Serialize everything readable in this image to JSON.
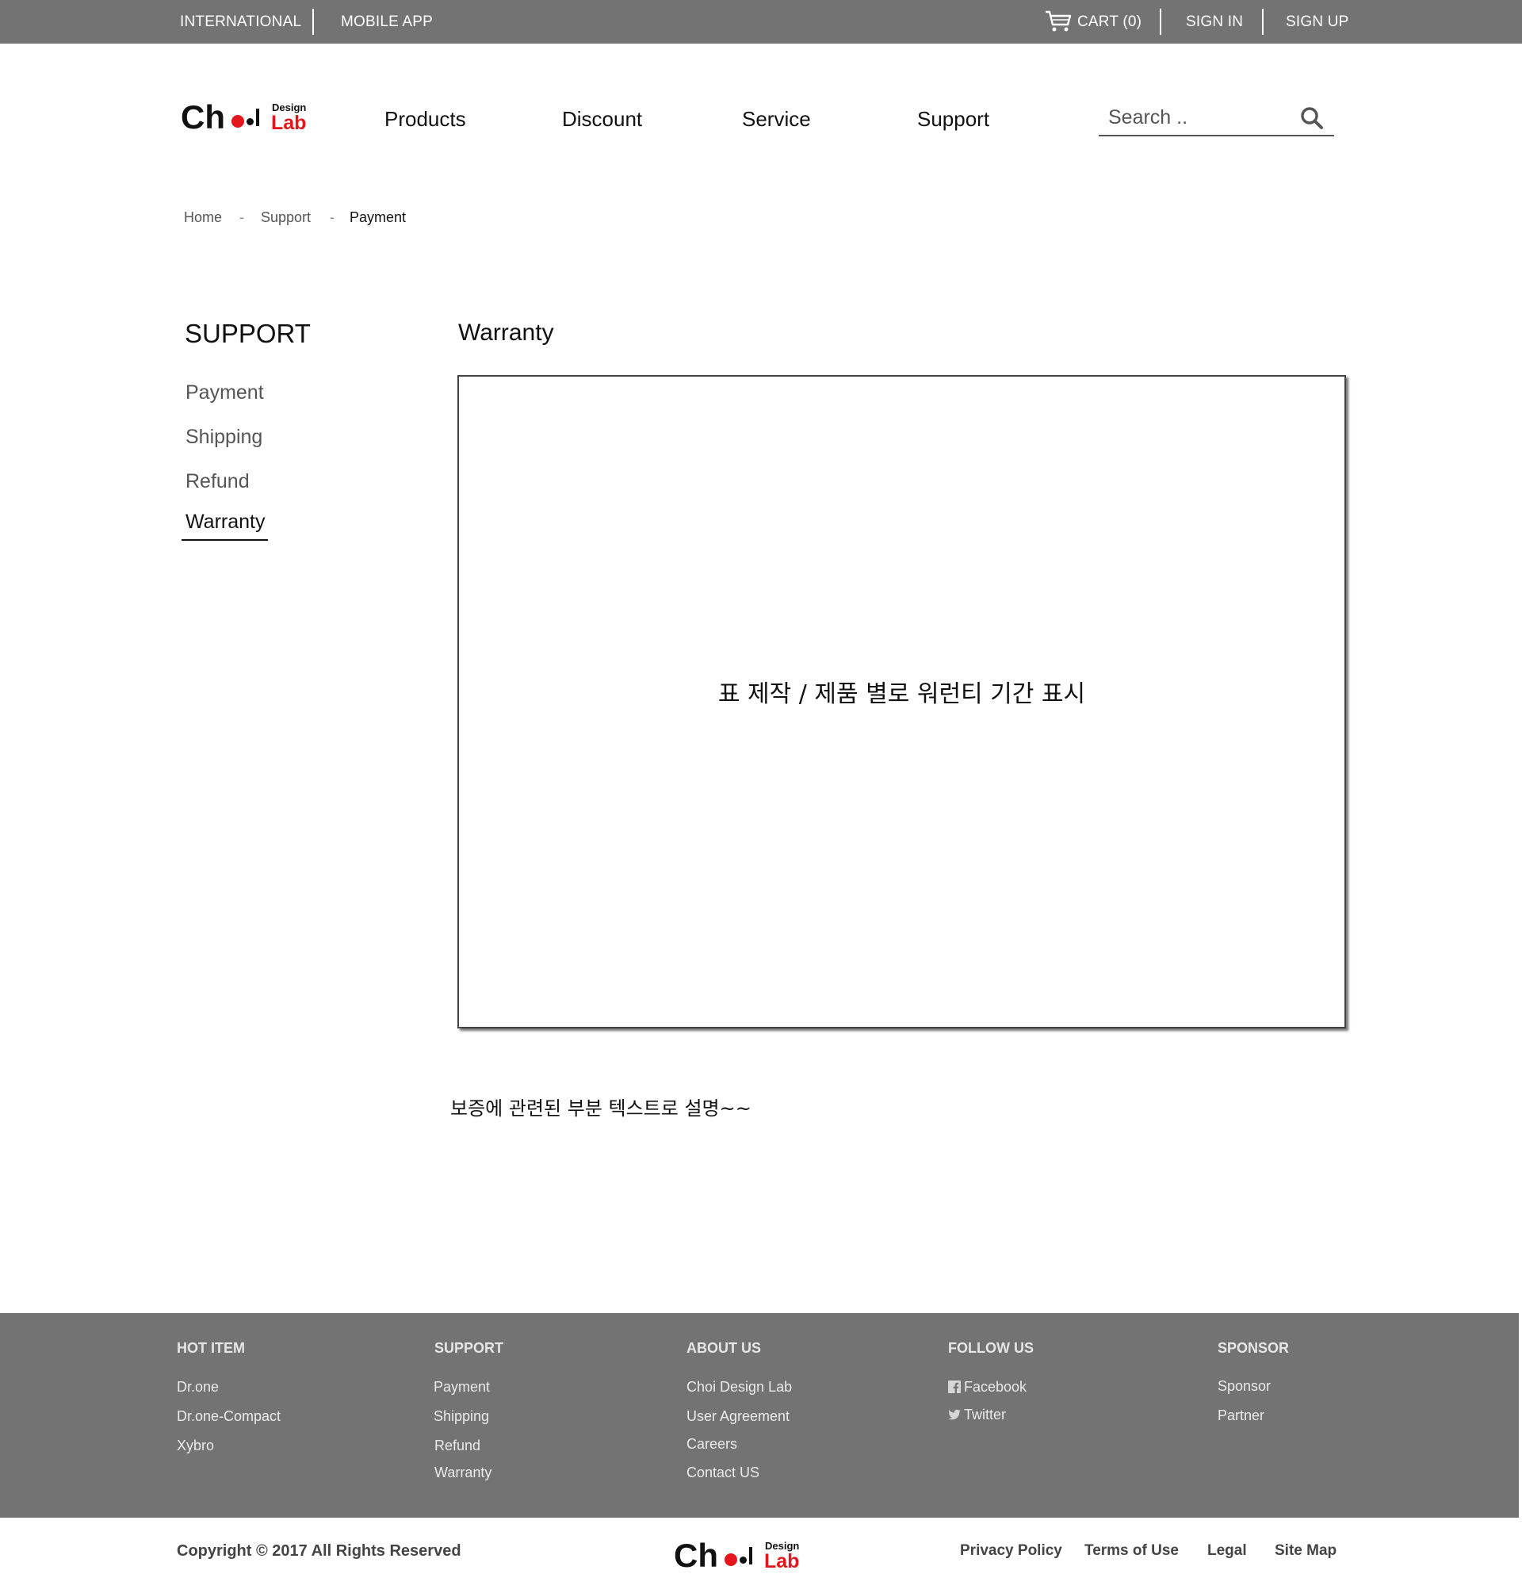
{
  "topbar": {
    "international": "INTERNATIONAL",
    "mobile_app": "MOBILE APP",
    "cart": "CART (0)",
    "sign_in": "SIGN IN",
    "sign_up": "SIGN UP"
  },
  "brand": {
    "name_prefix": "Ch",
    "design": "Design",
    "lab": "Lab"
  },
  "nav": {
    "items": [
      "Products",
      "Discount",
      "Service",
      "Support"
    ]
  },
  "search": {
    "placeholder": "Search .."
  },
  "breadcrumb": {
    "home": "Home",
    "support": "Support",
    "current": "Payment",
    "separator": "-"
  },
  "sidebar": {
    "title": "SUPPORT",
    "items": [
      "Payment",
      "Shipping",
      "Refund",
      "Warranty"
    ],
    "active": "Warranty"
  },
  "main": {
    "title": "Warranty",
    "table_placeholder": "표 제작 / 제품 별로 워런티 기간 표시",
    "description": "보증에 관련된 부분 텍스트로 설명~~"
  },
  "footer": {
    "columns": [
      {
        "heading": "HOT ITEM",
        "links": [
          "Dr.one",
          "Dr.one-Compact",
          "Xybro"
        ]
      },
      {
        "heading": "SUPPORT",
        "links": [
          "Payment",
          "Shipping",
          "Refund",
          "Warranty"
        ]
      },
      {
        "heading": "ABOUT US",
        "links": [
          "Choi Design Lab",
          "User Agreement",
          "Careers",
          "Contact US"
        ]
      },
      {
        "heading": "FOLLOW US",
        "links": [
          "Facebook",
          "Twitter"
        ]
      },
      {
        "heading": "SPONSOR",
        "links": [
          "Sponsor",
          "Partner"
        ]
      }
    ]
  },
  "bottom": {
    "copyright": "Copyright © 2017 All Rights Reserved",
    "links": [
      "Privacy Policy",
      "Terms of Use",
      "Legal",
      "Site Map"
    ]
  },
  "colors": {
    "bar_gray": "#737373",
    "accent_red": "#e4151b",
    "text_dark": "#111111"
  },
  "icons": {
    "cart": "cart-icon",
    "search": "search-icon",
    "facebook": "facebook-icon",
    "twitter": "twitter-icon"
  }
}
